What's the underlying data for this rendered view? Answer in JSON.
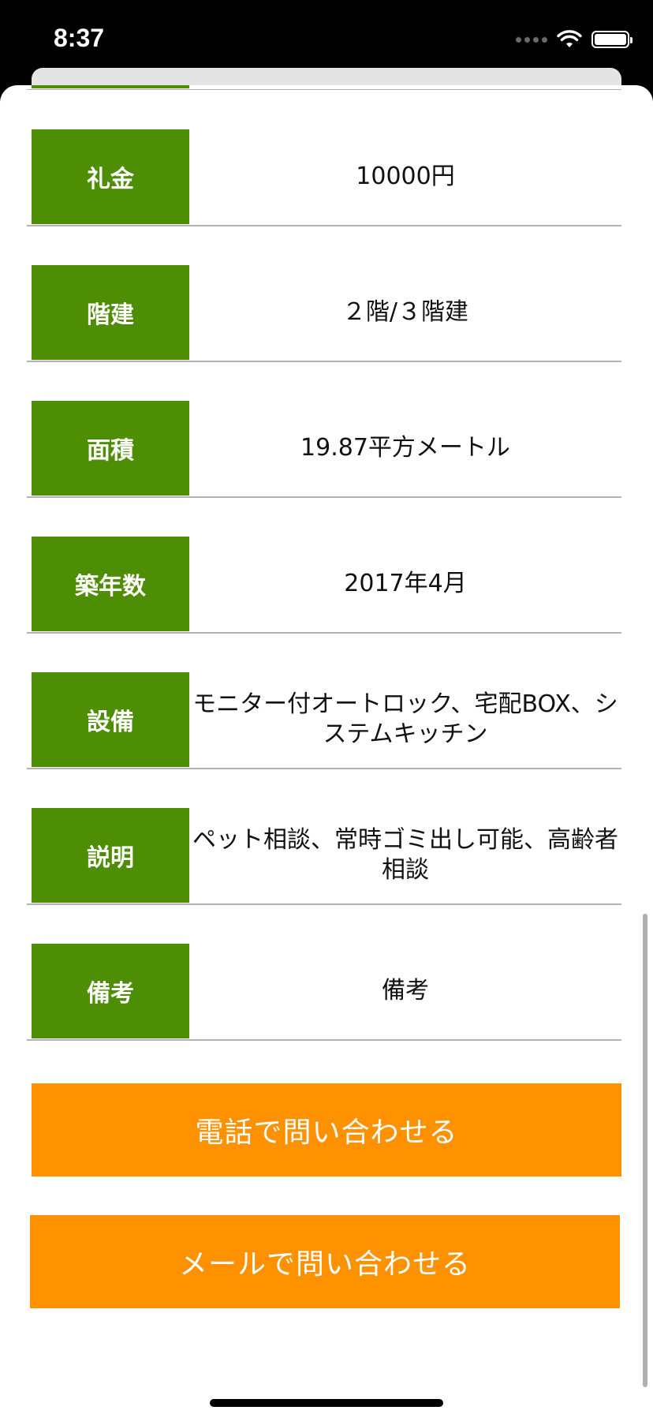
{
  "status_bar": {
    "time": "8:37"
  },
  "details": [
    {
      "label": "礼金",
      "value": "10000円"
    },
    {
      "label": "階建",
      "value": "２階/３階建"
    },
    {
      "label": "面積",
      "value": "19.87平方メートル"
    },
    {
      "label": "築年数",
      "value": "2017年4月"
    },
    {
      "label": "設備",
      "value": "モニター付オートロック、宅配BOX、システムキッチン"
    },
    {
      "label": "説明",
      "value": "ペット相談、常時ゴミ出し可能、高齢者相談"
    },
    {
      "label": "備考",
      "value": "備考"
    }
  ],
  "buttons": {
    "phone": "電話で問い合わせる",
    "mail": "メールで問い合わせる"
  },
  "colors": {
    "label_bg": "#4e8e04",
    "button_bg": "#fe9100",
    "divider": "#b3b3b3"
  }
}
